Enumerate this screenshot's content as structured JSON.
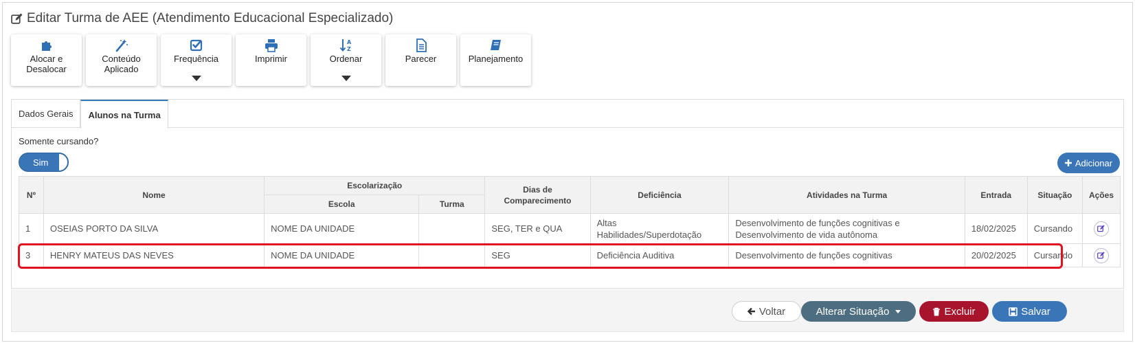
{
  "page": {
    "title": "Editar Turma de AEE (Atendimento Educacional Especializado)"
  },
  "toolbar": [
    {
      "label": "Alocar e Desalocar",
      "icon": "puzzle-icon",
      "dropdown": false
    },
    {
      "label": "Conteúdo Aplicado",
      "icon": "magic-wand-icon",
      "dropdown": false
    },
    {
      "label": "Frequência",
      "icon": "check-square-icon",
      "dropdown": true
    },
    {
      "label": "Imprimir",
      "icon": "printer-icon",
      "dropdown": false
    },
    {
      "label": "Ordenar",
      "icon": "sort-alpha-icon",
      "dropdown": true
    },
    {
      "label": "Parecer",
      "icon": "document-icon",
      "dropdown": false
    },
    {
      "label": "Planejamento",
      "icon": "book-icon",
      "dropdown": false
    }
  ],
  "tabs": [
    {
      "label": "Dados Gerais",
      "active": false
    },
    {
      "label": "Alunos na Turma",
      "active": true
    }
  ],
  "filter": {
    "label": "Somente cursando?",
    "toggle_label": "Sim",
    "toggle_on": true
  },
  "add_button": "Adicionar",
  "table": {
    "headers": {
      "num": "Nº",
      "nome": "Nome",
      "escolarizacao": "Escolarização",
      "escola": "Escola",
      "turma": "Turma",
      "dias": "Dias de Comparecimento",
      "deficiencia": "Deficiência",
      "atividades": "Atividades na Turma",
      "entrada": "Entrada",
      "situacao": "Situação",
      "acoes": "Ações"
    },
    "rows": [
      {
        "num": "1",
        "nome": "OSEIAS PORTO DA SILVA",
        "escola": "NOME DA UNIDADE",
        "turma": "",
        "dias": "SEG, TER e QUA",
        "deficiencia": "Altas Habilidades/Superdotação",
        "atividades": "Desenvolvimento de funções cognitivas e Desenvolvimento de vida autônoma",
        "entrada": "18/02/2025",
        "situacao": "Cursando"
      },
      {
        "num": "3",
        "nome": "HENRY MATEUS DAS NEVES",
        "escola": "NOME DA UNIDADE",
        "turma": "",
        "dias": "SEG",
        "deficiencia": "Deficiência Auditiva",
        "atividades": "Desenvolvimento de funções cognitivas",
        "entrada": "20/02/2025",
        "situacao": "Cursando",
        "highlighted": true
      }
    ]
  },
  "footer": {
    "back": "Voltar",
    "alter_status": "Alterar Situação",
    "delete": "Excluir",
    "save": "Salvar"
  },
  "colors": {
    "primary": "#3a75b8",
    "secondary": "#4d6e80",
    "danger": "#a8142c",
    "highlight": "#e0121f"
  }
}
